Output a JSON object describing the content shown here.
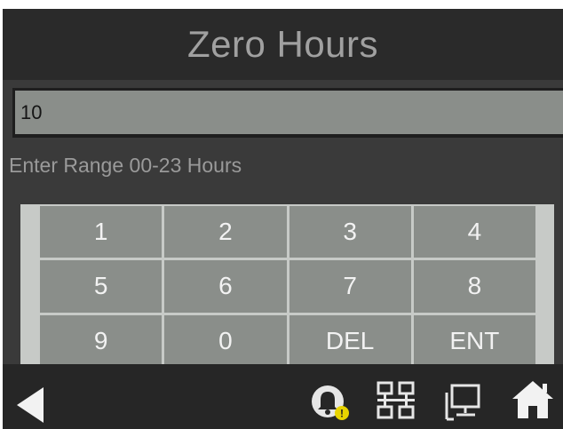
{
  "header": {
    "title": "Zero Hours"
  },
  "entry": {
    "value": "10"
  },
  "hint": "Enter Range 00-23 Hours",
  "keypad": {
    "keys": [
      "1",
      "2",
      "3",
      "4",
      "5",
      "6",
      "7",
      "8",
      "9",
      "0",
      "DEL",
      "ENT"
    ]
  },
  "footer": {
    "icons": [
      "back-arrow-icon",
      "alarm-bell-icon",
      "network-icon",
      "monitor-icon",
      "home-icon"
    ],
    "alarm_badge": "!"
  },
  "colors": {
    "background": "#3a3a3a",
    "header": "#2a2a2a",
    "key": "#8a8e8a",
    "keypad_frame": "#c7cac7",
    "footer": "#262626",
    "badge": "#e8d400"
  }
}
